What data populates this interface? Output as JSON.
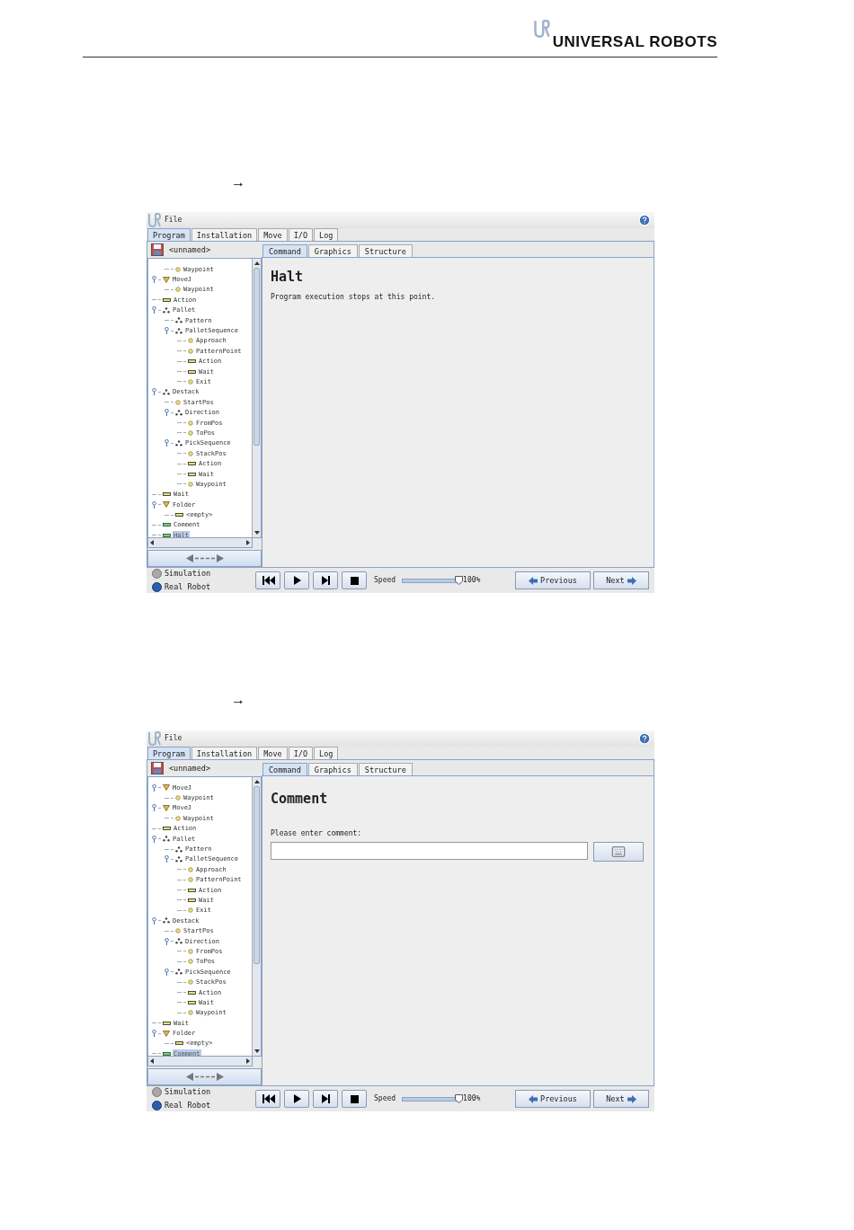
{
  "header": {
    "brand": "UNIVERSAL ROBOTS"
  },
  "sections": [
    {
      "arrow": "→",
      "screen": {
        "menu": "File",
        "tabs": [
          {
            "label": "Program",
            "selected": true
          },
          {
            "label": "Installation",
            "selected": false
          },
          {
            "label": "Move",
            "selected": false
          },
          {
            "label": "I/O",
            "selected": false
          },
          {
            "label": "Log",
            "selected": false
          }
        ],
        "program_name": "<unnamed>",
        "tree": [
          {
            "children": [
              {
                "label": "Waypoint",
                "kind": "point",
                "selected": false
              }
            ]
          },
          {
            "label": "MoveJ",
            "kind": "move",
            "selected": false,
            "children": [
              {
                "label": "Waypoint",
                "kind": "point",
                "selected": false
              }
            ]
          },
          {
            "label": "Action",
            "kind": "bar",
            "selected": false
          },
          {
            "label": "Pallet",
            "kind": "dots",
            "selected": false,
            "children": [
              {
                "label": "Pattern",
                "kind": "dots",
                "selected": false
              },
              {
                "label": "PalletSequence",
                "kind": "dots",
                "selected": false,
                "children": [
                  {
                    "label": "Approach",
                    "kind": "point",
                    "selected": false
                  },
                  {
                    "label": "PatternPoint",
                    "kind": "point",
                    "selected": false
                  },
                  {
                    "label": "Action",
                    "kind": "bar",
                    "selected": false
                  },
                  {
                    "label": "Wait",
                    "kind": "bar",
                    "selected": false
                  },
                  {
                    "label": "Exit",
                    "kind": "point",
                    "selected": false
                  }
                ]
              }
            ]
          },
          {
            "label": "Destack",
            "kind": "dots",
            "selected": false,
            "children": [
              {
                "label": "StartPos",
                "kind": "point",
                "selected": false
              },
              {
                "label": "Direction",
                "kind": "dots",
                "selected": false,
                "children": [
                  {
                    "label": "FromPos",
                    "kind": "point",
                    "selected": false
                  },
                  {
                    "label": "ToPos",
                    "kind": "point",
                    "selected": false
                  }
                ]
              },
              {
                "label": "PickSequence",
                "kind": "dots",
                "selected": false,
                "children": [
                  {
                    "label": "StackPos",
                    "kind": "point",
                    "selected": false
                  },
                  {
                    "label": "Action",
                    "kind": "bar",
                    "selected": false
                  },
                  {
                    "label": "Wait",
                    "kind": "bar",
                    "selected": false
                  },
                  {
                    "label": "Waypoint",
                    "kind": "point",
                    "selected": false
                  }
                ]
              }
            ]
          },
          {
            "label": "Wait",
            "kind": "bar",
            "selected": false
          },
          {
            "label": "Folder",
            "kind": "move",
            "selected": false,
            "children": [
              {
                "label": "<empty>",
                "kind": "bar",
                "selected": false
              }
            ]
          },
          {
            "label": "Comment",
            "kind": "greenbar",
            "selected": false
          },
          {
            "label": "Halt",
            "kind": "greenbar",
            "selected": true
          }
        ],
        "subtabs": [
          {
            "label": "Command",
            "selected": true
          },
          {
            "label": "Graphics",
            "selected": false
          },
          {
            "label": "Structure",
            "selected": false
          }
        ],
        "content": {
          "kind": "halt",
          "title": "Halt",
          "text": "Program execution stops at this point."
        },
        "modes": [
          {
            "label": "Simulation",
            "selected": false
          },
          {
            "label": "Real Robot",
            "selected": true
          }
        ],
        "speed": {
          "label": "Speed",
          "level": 1,
          "reading": "100%"
        },
        "previous": "Previous",
        "next": "Next"
      }
    },
    {
      "arrow": "→",
      "screen": {
        "menu": "File",
        "tabs": [
          {
            "label": "Program",
            "selected": true
          },
          {
            "label": "Installation",
            "selected": false
          },
          {
            "label": "Move",
            "selected": false
          },
          {
            "label": "I/O",
            "selected": false
          },
          {
            "label": "Log",
            "selected": false
          }
        ],
        "program_name": "<unnamed>",
        "tree": [
          {
            "label": "MoveJ",
            "kind": "move",
            "selected": false,
            "children": [
              {
                "label": "Waypoint",
                "kind": "point",
                "selected": false
              }
            ]
          },
          {
            "label": "MoveJ",
            "kind": "move",
            "selected": false,
            "children": [
              {
                "label": "Waypoint",
                "kind": "point",
                "selected": false
              }
            ]
          },
          {
            "label": "Action",
            "kind": "bar",
            "selected": false
          },
          {
            "label": "Pallet",
            "kind": "dots",
            "selected": false,
            "children": [
              {
                "label": "Pattern",
                "kind": "dots",
                "selected": false
              },
              {
                "label": "PalletSequence",
                "kind": "dots",
                "selected": false,
                "children": [
                  {
                    "label": "Approach",
                    "kind": "point",
                    "selected": false
                  },
                  {
                    "label": "PatternPoint",
                    "kind": "point",
                    "selected": false
                  },
                  {
                    "label": "Action",
                    "kind": "bar",
                    "selected": false
                  },
                  {
                    "label": "Wait",
                    "kind": "bar",
                    "selected": false
                  },
                  {
                    "label": "Exit",
                    "kind": "point",
                    "selected": false
                  }
                ]
              }
            ]
          },
          {
            "label": "Destack",
            "kind": "dots",
            "selected": false,
            "children": [
              {
                "label": "StartPos",
                "kind": "point",
                "selected": false
              },
              {
                "label": "Direction",
                "kind": "dots",
                "selected": false,
                "children": [
                  {
                    "label": "FromPos",
                    "kind": "point",
                    "selected": false
                  },
                  {
                    "label": "ToPos",
                    "kind": "point",
                    "selected": false
                  }
                ]
              },
              {
                "label": "PickSequence",
                "kind": "dots",
                "selected": false,
                "children": [
                  {
                    "label": "StackPos",
                    "kind": "point",
                    "selected": false
                  },
                  {
                    "label": "Action",
                    "kind": "bar",
                    "selected": false
                  },
                  {
                    "label": "Wait",
                    "kind": "bar",
                    "selected": false
                  },
                  {
                    "label": "Waypoint",
                    "kind": "point",
                    "selected": false
                  }
                ]
              }
            ]
          },
          {
            "label": "Wait",
            "kind": "bar",
            "selected": false
          },
          {
            "label": "Folder",
            "kind": "move",
            "selected": false,
            "children": [
              {
                "label": "<empty>",
                "kind": "bar",
                "selected": false
              }
            ]
          },
          {
            "label": "Comment",
            "kind": "greenbar",
            "selected": true
          }
        ],
        "subtabs": [
          {
            "label": "Command",
            "selected": true
          },
          {
            "label": "Graphics",
            "selected": false
          },
          {
            "label": "Structure",
            "selected": false
          }
        ],
        "content": {
          "kind": "comment",
          "title": "Comment",
          "field_label": "Please enter comment:"
        },
        "modes": [
          {
            "label": "Simulation",
            "selected": false
          },
          {
            "label": "Real Robot",
            "selected": true
          }
        ],
        "speed": {
          "label": "Speed",
          "level": 1,
          "reading": "100%"
        },
        "previous": "Previous",
        "next": "Next"
      }
    }
  ]
}
